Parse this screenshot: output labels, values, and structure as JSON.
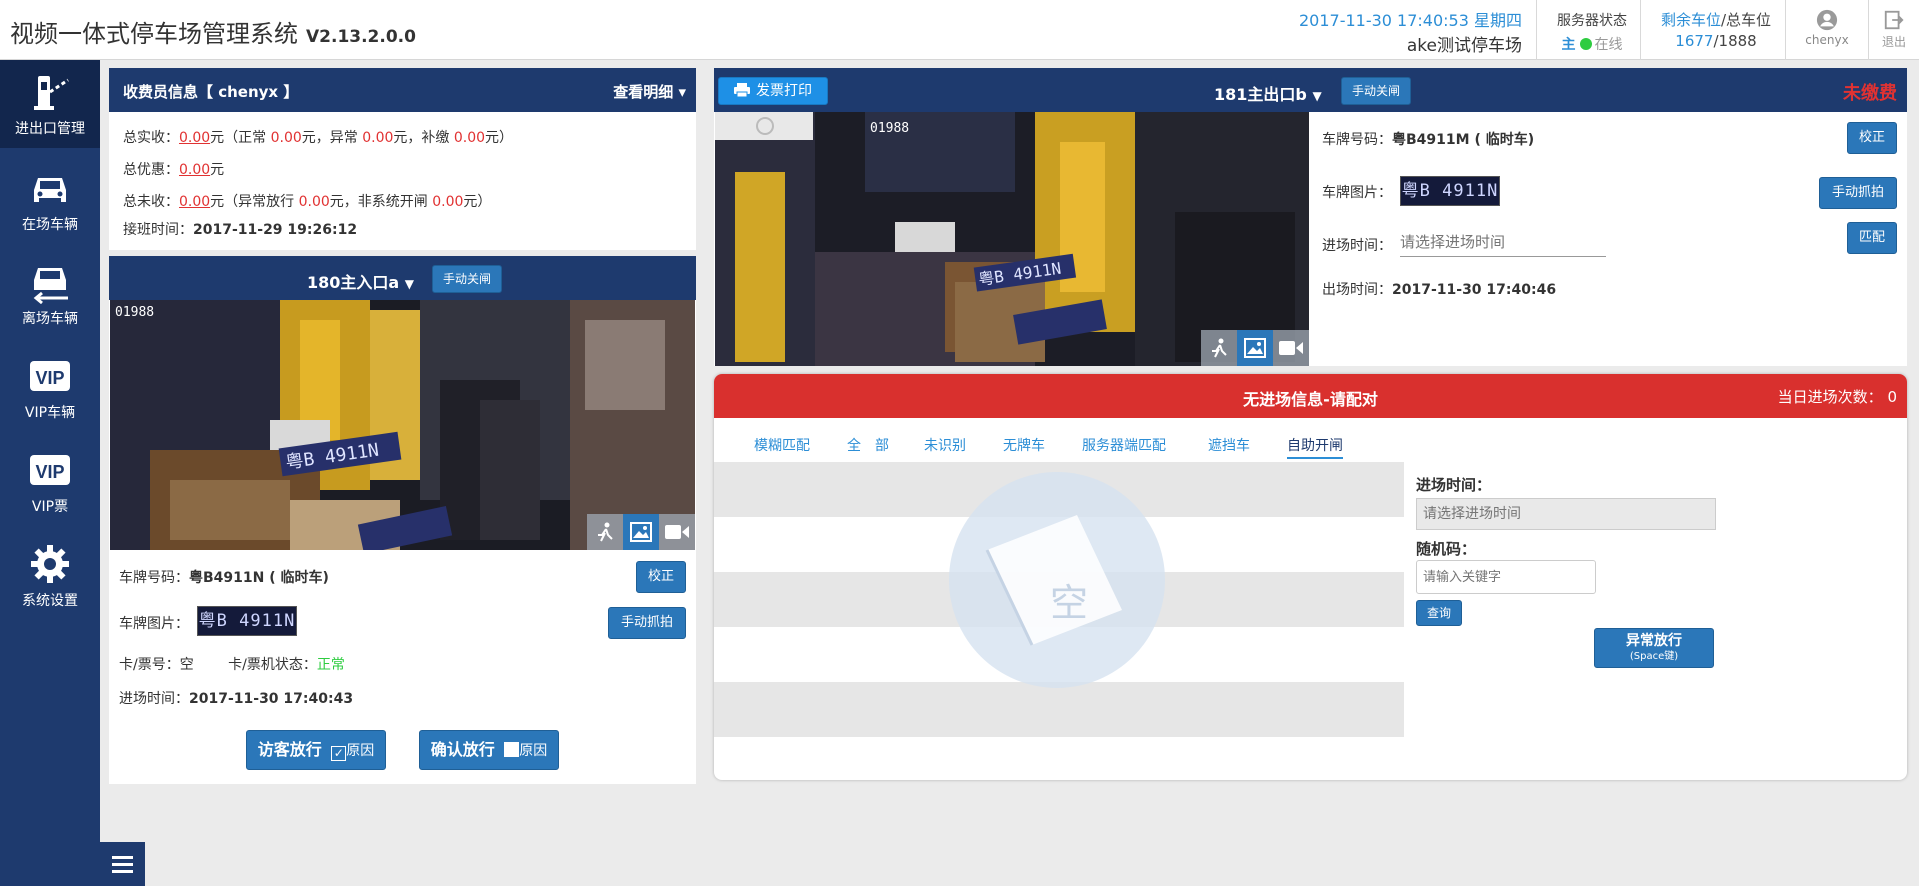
{
  "app": {
    "title": "视频一体式停车场管理系统",
    "version": "V2.13.2.0.0",
    "datetime": "2017-11-30 17:40:53 星期四",
    "lot_name": "ake测试停车场"
  },
  "server": {
    "title": "服务器状态",
    "main": "主",
    "status": "在线"
  },
  "spaces": {
    "label_remaining": "剩余车位",
    "sep": "/",
    "label_total": "总车位",
    "remaining": "1677",
    "total_sep": "/",
    "total": "1888"
  },
  "user": {
    "name": "chenyx",
    "logout": "退出"
  },
  "sidebar": {
    "items": [
      {
        "label": "进出口管理"
      },
      {
        "label": "在场车辆"
      },
      {
        "label": "离场车辆"
      },
      {
        "label": "VIP车辆"
      },
      {
        "label": "VIP票"
      },
      {
        "label": "系统设置"
      }
    ]
  },
  "cashier": {
    "title": "收费员信息【 chenyx 】",
    "detail_link": "查看明细",
    "actual_label": "总实收：",
    "actual_value": "0.00",
    "unit": "元",
    "open_paren": "（正常 ",
    "normal_value": "0.00",
    "abnormal_text": "元，异常 ",
    "abnormal_value": "0.00",
    "extra_text": "元，补缴 ",
    "extra_value": "0.00",
    "close_paren": "元）",
    "discount_label": "总优惠：",
    "discount_value": "0.00",
    "unpaid_label": "总未收：",
    "unpaid_value": "0.00",
    "unpaid_paren": "（异常放行 ",
    "unpaid_abn_value": "0.00",
    "unpaid_nonsys_text": "元，非系统开闸 ",
    "unpaid_nonsys_value": "0.00",
    "shift_label": "接班时间：",
    "shift_time": "2017-11-29 19:26:12"
  },
  "entrance": {
    "channel": "180主入口a",
    "manual_close": "手动关闸",
    "plate_label": "车牌号码：",
    "plate": "粤B4911N ( 临时车)",
    "correct_btn": "校正",
    "plate_img_label": "车牌图片：",
    "plate_img_text": "粤B 4911N",
    "capture_btn": "手动抓拍",
    "card_label": "卡/票号：",
    "card_value": "空",
    "card_status_label": "卡/票机状态：",
    "card_status": "正常",
    "entry_label": "进场时间：",
    "entry_time": "2017-11-30 17:40:43",
    "visitor_btn": "访客放行",
    "confirm_btn": "确认放行",
    "reason": "原因",
    "cam_text": "01988",
    "cam_plate": "粤B 4911N"
  },
  "exit": {
    "print_btn": "发票打印",
    "channel": "181主出口b",
    "manual_close": "手动关闸",
    "unpaid_tag": "未缴费",
    "plate_label": "车牌号码：",
    "plate": "粤B4911M ( 临时车)",
    "correct_btn": "校正",
    "plate_img_label": "车牌图片：",
    "plate_img_text": "粤B 4911N",
    "capture_btn": "手动抓拍",
    "entry_label": "进场时间：",
    "entry_placeholder": "请选择进场时间",
    "match_btn": "匹配",
    "exit_label": "出场时间：",
    "exit_time": "2017-11-30 17:40:46",
    "cam_text": "01988",
    "cam_plate": "粤B 4911N"
  },
  "match": {
    "title": "无进场信息-请配对",
    "count_label": "当日进场次数：",
    "count": "0",
    "tabs": [
      "模糊匹配",
      "全　部",
      "未识别",
      "无牌车",
      "服务器端匹配",
      "遮挡车",
      "自助开闸"
    ],
    "active_tab": 6,
    "empty_text": "空",
    "entry_label": "进场时间：",
    "entry_placeholder": "请选择进场时间",
    "random_label": "随机码：",
    "random_placeholder": "请输入关键字",
    "query_btn": "查询",
    "abnormal_btn": "异常放行",
    "abnormal_sub": "(Space键)"
  },
  "colors": {
    "navy": "#1e3a6e",
    "accent": "#2b77b9",
    "red": "#e13232",
    "link": "#2c8ed6",
    "green": "#2ecc40"
  }
}
